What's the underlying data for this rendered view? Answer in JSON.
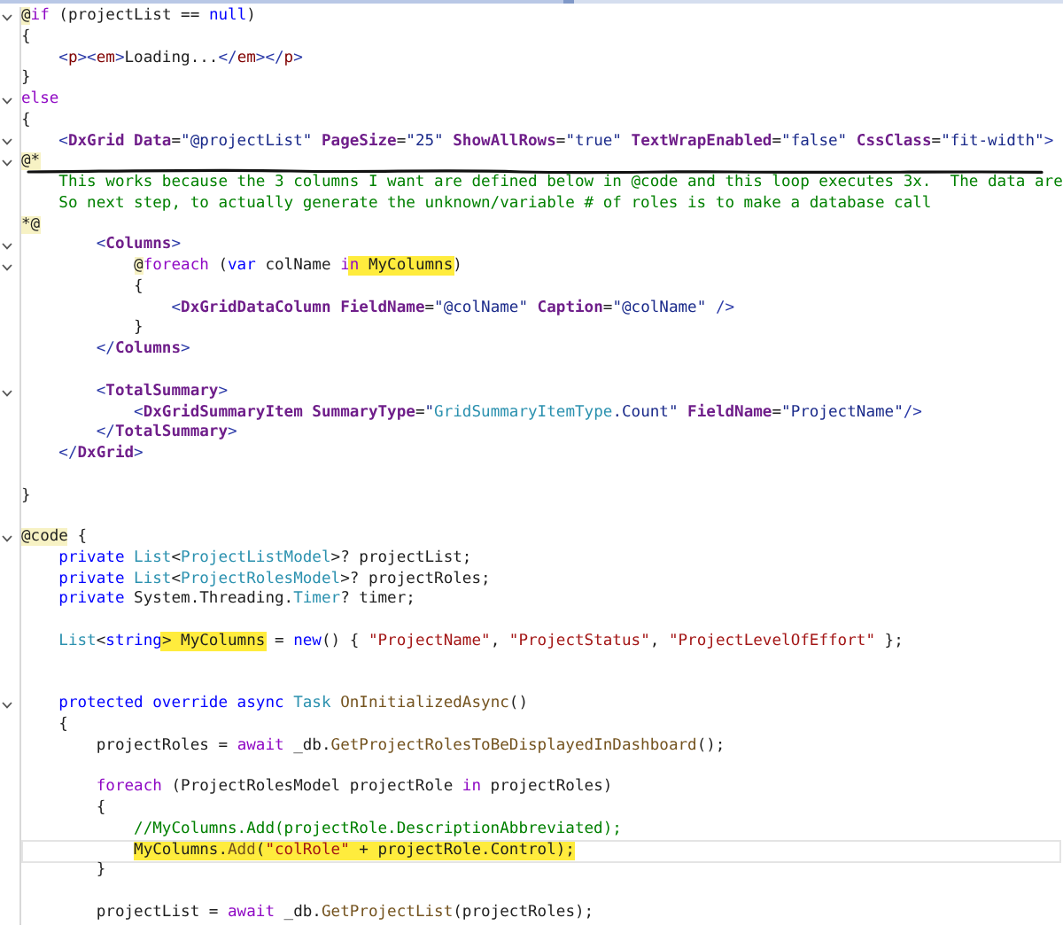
{
  "editor": {
    "lines": [
      {
        "kind": "code",
        "fold": true,
        "current": false,
        "struck": false,
        "tokens": [
          {
            "text": "@",
            "kind": "razor"
          },
          {
            "text": "if",
            "kind": "ctl"
          },
          {
            "text": " (projectList == ",
            "kind": "pl"
          },
          {
            "text": "null",
            "kind": "kw"
          },
          {
            "text": ")",
            "kind": "pl"
          }
        ]
      },
      {
        "kind": "code",
        "fold": false,
        "current": false,
        "struck": false,
        "tokens": [
          {
            "text": "{",
            "kind": "pl"
          }
        ],
        "children": [
          {
            "kind": "code",
            "fold": false,
            "current": false,
            "struck": false,
            "tokens": [
              {
                "text": "<",
                "kind": "dl"
              },
              {
                "text": "p",
                "kind": "tag"
              },
              {
                "text": "><",
                "kind": "dl"
              },
              {
                "text": "em",
                "kind": "tag"
              },
              {
                "text": ">",
                "kind": "dl"
              },
              {
                "text": "Loading...",
                "kind": "pl"
              },
              {
                "text": "</",
                "kind": "dl"
              },
              {
                "text": "em",
                "kind": "tag"
              },
              {
                "text": "></",
                "kind": "dl"
              },
              {
                "text": "p",
                "kind": "tag"
              },
              {
                "text": ">",
                "kind": "dl"
              }
            ]
          }
        ]
      },
      {
        "kind": "code",
        "fold": false,
        "current": false,
        "struck": false,
        "tokens": [
          {
            "text": "}",
            "kind": "pl"
          }
        ]
      },
      {
        "kind": "code",
        "fold": true,
        "current": false,
        "struck": false,
        "tokens": [
          {
            "text": "else",
            "kind": "ctl"
          }
        ]
      },
      {
        "kind": "code",
        "fold": false,
        "current": false,
        "struck": false,
        "tokens": [
          {
            "text": "{",
            "kind": "pl"
          }
        ],
        "children": [
          {
            "kind": "code",
            "fold": true,
            "current": false,
            "struck": false,
            "tokens": [
              {
                "text": "<",
                "kind": "dl"
              },
              {
                "text": "DxGrid",
                "kind": "comp"
              },
              {
                "text": " Data",
                "kind": "attr"
              },
              {
                "text": "=",
                "kind": "pl"
              },
              {
                "text": "\"@projectList\"",
                "kind": "val"
              },
              {
                "text": " PageSize",
                "kind": "attr"
              },
              {
                "text": "=",
                "kind": "pl"
              },
              {
                "text": "\"25\"",
                "kind": "val"
              },
              {
                "text": " ShowAllRows",
                "kind": "attr"
              },
              {
                "text": "=",
                "kind": "pl"
              },
              {
                "text": "\"true\"",
                "kind": "val"
              },
              {
                "text": " TextWrapEnabled",
                "kind": "attr"
              },
              {
                "text": "=",
                "kind": "pl"
              },
              {
                "text": "\"false\"",
                "kind": "val"
              },
              {
                "text": " CssClass",
                "kind": "attr"
              },
              {
                "text": "=",
                "kind": "pl"
              },
              {
                "text": "\"fit-width\"",
                "kind": "val"
              },
              {
                "text": ">",
                "kind": "dl"
              }
            ]
          }
        ]
      },
      {
        "kind": "code",
        "fold": true,
        "current": false,
        "struck": false,
        "tokens": [
          {
            "text": "@*",
            "kind": "razor"
          }
        ],
        "children": [
          {
            "kind": "code",
            "fold": false,
            "current": false,
            "struck": true,
            "tokens": [
              {
                "text": "This works because the 3 columns I want are defined below in @code and this loop executes 3x.  The data are",
                "kind": "cm"
              }
            ]
          },
          {
            "kind": "code",
            "fold": false,
            "current": false,
            "struck": false,
            "tokens": [
              {
                "text": "So next step, to actually generate the unknown/variable # of roles is to make a database call",
                "kind": "cm"
              }
            ]
          }
        ]
      },
      {
        "kind": "code",
        "fold": false,
        "current": false,
        "struck": false,
        "tokens": [
          {
            "text": "*@",
            "kind": "razor"
          }
        ],
        "children": [
          {
            "kind": "block",
            "children": [
              {
                "kind": "code",
                "fold": true,
                "current": false,
                "struck": false,
                "tokens": [
                  {
                    "text": "<",
                    "kind": "dl"
                  },
                  {
                    "text": "Columns",
                    "kind": "comp"
                  },
                  {
                    "text": ">",
                    "kind": "dl"
                  }
                ],
                "children": [
                  {
                    "kind": "code",
                    "fold": true,
                    "current": false,
                    "struck": false,
                    "tokens": [
                      {
                        "text": "@",
                        "kind": "razor",
                        "highlighted": false
                      },
                      {
                        "text": "foreach",
                        "kind": "ctl",
                        "highlighted": false
                      },
                      {
                        "text": " (",
                        "kind": "pl",
                        "highlighted": false
                      },
                      {
                        "text": "var",
                        "kind": "kw",
                        "highlighted": false
                      },
                      {
                        "text": " colName ",
                        "kind": "pl",
                        "highlighted": false
                      },
                      {
                        "text": "i",
                        "kind": "ctl",
                        "highlighted": false
                      },
                      {
                        "text": "n",
                        "kind": "ctl",
                        "highlighted": true
                      },
                      {
                        "text": " MyColumns",
                        "kind": "pl",
                        "highlighted": true
                      },
                      {
                        "text": ")",
                        "kind": "pl",
                        "highlighted": false
                      }
                    ]
                  },
                  {
                    "kind": "code",
                    "fold": false,
                    "current": false,
                    "struck": false,
                    "tokens": [
                      {
                        "text": "{",
                        "kind": "pl"
                      }
                    ],
                    "children": [
                      {
                        "kind": "code",
                        "fold": false,
                        "current": false,
                        "struck": false,
                        "tokens": [
                          {
                            "text": "<",
                            "kind": "dl"
                          },
                          {
                            "text": "DxGridDataColumn",
                            "kind": "comp"
                          },
                          {
                            "text": " FieldName",
                            "kind": "attr"
                          },
                          {
                            "text": "=",
                            "kind": "pl"
                          },
                          {
                            "text": "\"@colName\"",
                            "kind": "val"
                          },
                          {
                            "text": " Caption",
                            "kind": "attr"
                          },
                          {
                            "text": "=",
                            "kind": "pl"
                          },
                          {
                            "text": "\"@colName\"",
                            "kind": "val"
                          },
                          {
                            "text": " />",
                            "kind": "dl"
                          }
                        ]
                      }
                    ]
                  },
                  {
                    "kind": "code",
                    "fold": false,
                    "current": false,
                    "struck": false,
                    "tokens": [
                      {
                        "text": "}",
                        "kind": "pl"
                      }
                    ]
                  }
                ]
              },
              {
                "kind": "code",
                "fold": false,
                "current": false,
                "struck": false,
                "tokens": [
                  {
                    "text": "</",
                    "kind": "dl"
                  },
                  {
                    "text": "Columns",
                    "kind": "comp"
                  },
                  {
                    "text": ">",
                    "kind": "dl"
                  }
                ]
              },
              {
                "kind": "blank"
              },
              {
                "kind": "code",
                "fold": true,
                "current": false,
                "struck": false,
                "tokens": [
                  {
                    "text": "<",
                    "kind": "dl"
                  },
                  {
                    "text": "TotalSummary",
                    "kind": "comp"
                  },
                  {
                    "text": ">",
                    "kind": "dl"
                  }
                ],
                "children": [
                  {
                    "kind": "code",
                    "fold": false,
                    "current": false,
                    "struck": false,
                    "tokens": [
                      {
                        "text": "<",
                        "kind": "dl"
                      },
                      {
                        "text": "DxGridSummaryItem",
                        "kind": "comp"
                      },
                      {
                        "text": " SummaryType",
                        "kind": "attr"
                      },
                      {
                        "text": "=",
                        "kind": "pl"
                      },
                      {
                        "text": "\"",
                        "kind": "val"
                      },
                      {
                        "text": "GridSummaryItemType",
                        "kind": "type"
                      },
                      {
                        "text": ".Count\"",
                        "kind": "val"
                      },
                      {
                        "text": " FieldName",
                        "kind": "attr"
                      },
                      {
                        "text": "=",
                        "kind": "pl"
                      },
                      {
                        "text": "\"ProjectName\"",
                        "kind": "val"
                      },
                      {
                        "text": "/>",
                        "kind": "dl"
                      }
                    ]
                  }
                ]
              },
              {
                "kind": "code",
                "fold": false,
                "current": false,
                "struck": false,
                "tokens": [
                  {
                    "text": "</",
                    "kind": "dl"
                  },
                  {
                    "text": "TotalSummary",
                    "kind": "comp"
                  },
                  {
                    "text": ">",
                    "kind": "dl"
                  }
                ]
              }
            ]
          },
          {
            "kind": "code",
            "fold": false,
            "current": false,
            "struck": false,
            "tokens": [
              {
                "text": "</",
                "kind": "dl"
              },
              {
                "text": "DxGrid",
                "kind": "comp"
              },
              {
                "text": ">",
                "kind": "dl"
              }
            ]
          },
          {
            "kind": "blank"
          }
        ]
      },
      {
        "kind": "code",
        "fold": false,
        "current": false,
        "struck": false,
        "tokens": [
          {
            "text": "}",
            "kind": "pl"
          }
        ]
      },
      {
        "kind": "blank"
      },
      {
        "kind": "code",
        "fold": true,
        "current": false,
        "struck": false,
        "tokens": [
          {
            "text": "@code",
            "kind": "razor"
          },
          {
            "text": " {",
            "kind": "pl"
          }
        ],
        "children": [
          {
            "kind": "code",
            "fold": false,
            "current": false,
            "struck": false,
            "tokens": [
              {
                "text": "private",
                "kind": "kw"
              },
              {
                "text": " List",
                "kind": "type"
              },
              {
                "text": "<",
                "kind": "pl"
              },
              {
                "text": "ProjectListModel",
                "kind": "type"
              },
              {
                "text": ">? projectList;",
                "kind": "pl"
              }
            ]
          },
          {
            "kind": "code",
            "fold": false,
            "current": false,
            "struck": false,
            "tokens": [
              {
                "text": "private",
                "kind": "kw"
              },
              {
                "text": " List",
                "kind": "type"
              },
              {
                "text": "<",
                "kind": "pl"
              },
              {
                "text": "ProjectRolesModel",
                "kind": "type"
              },
              {
                "text": ">? projectRoles;",
                "kind": "pl"
              }
            ]
          },
          {
            "kind": "code",
            "fold": false,
            "current": false,
            "struck": false,
            "tokens": [
              {
                "text": "private",
                "kind": "kw"
              },
              {
                "text": " System.Threading.",
                "kind": "pl"
              },
              {
                "text": "Timer",
                "kind": "type"
              },
              {
                "text": "? timer;",
                "kind": "pl"
              }
            ]
          },
          {
            "kind": "blank"
          },
          {
            "kind": "code",
            "fold": false,
            "current": false,
            "struck": false,
            "tokens": [
              {
                "text": "List",
                "kind": "type",
                "highlighted": false
              },
              {
                "text": "<",
                "kind": "pl",
                "highlighted": false
              },
              {
                "text": "string",
                "kind": "kw",
                "highlighted": false
              },
              {
                "text": "> MyColumns",
                "kind": "pl",
                "highlighted": true
              },
              {
                "text": " = ",
                "kind": "pl",
                "highlighted": false
              },
              {
                "text": "new",
                "kind": "kw",
                "highlighted": false
              },
              {
                "text": "() { ",
                "kind": "pl",
                "highlighted": false
              },
              {
                "text": "\"ProjectName\"",
                "kind": "str",
                "highlighted": false
              },
              {
                "text": ", ",
                "kind": "pl",
                "highlighted": false
              },
              {
                "text": "\"ProjectStatus\"",
                "kind": "str",
                "highlighted": false
              },
              {
                "text": ", ",
                "kind": "pl",
                "highlighted": false
              },
              {
                "text": "\"ProjectLevelOfEffort\"",
                "kind": "str",
                "highlighted": false
              },
              {
                "text": " };",
                "kind": "pl",
                "highlighted": false
              }
            ]
          },
          {
            "kind": "blank"
          },
          {
            "kind": "blank"
          },
          {
            "kind": "code",
            "fold": true,
            "current": false,
            "struck": false,
            "tokens": [
              {
                "text": "protected",
                "kind": "kw"
              },
              {
                "text": " override",
                "kind": "kw"
              },
              {
                "text": " async",
                "kind": "kw"
              },
              {
                "text": " Task",
                "kind": "type"
              },
              {
                "text": " OnInitializedAsync",
                "kind": "fn"
              },
              {
                "text": "()",
                "kind": "pl"
              }
            ]
          },
          {
            "kind": "code",
            "fold": false,
            "current": false,
            "struck": false,
            "tokens": [
              {
                "text": "{",
                "kind": "pl"
              }
            ],
            "children": [
              {
                "kind": "code",
                "fold": false,
                "current": false,
                "struck": false,
                "tokens": [
                  {
                    "text": "projectRoles = ",
                    "kind": "pl"
                  },
                  {
                    "text": "await",
                    "kind": "ctl"
                  },
                  {
                    "text": " _db.",
                    "kind": "pl"
                  },
                  {
                    "text": "GetProjectRolesToBeDisplayedInDashboard",
                    "kind": "fn"
                  },
                  {
                    "text": "();",
                    "kind": "pl"
                  }
                ]
              },
              {
                "kind": "blank"
              },
              {
                "kind": "code",
                "fold": false,
                "current": false,
                "struck": false,
                "tokens": [
                  {
                    "text": "foreach",
                    "kind": "ctl"
                  },
                  {
                    "text": " (ProjectRolesModel projectRole ",
                    "kind": "pl"
                  },
                  {
                    "text": "in",
                    "kind": "ctl"
                  },
                  {
                    "text": " projectRoles)",
                    "kind": "pl"
                  }
                ]
              },
              {
                "kind": "code",
                "fold": false,
                "current": false,
                "struck": false,
                "tokens": [
                  {
                    "text": "{",
                    "kind": "pl"
                  }
                ],
                "children": [
                  {
                    "kind": "code",
                    "fold": false,
                    "current": false,
                    "struck": false,
                    "tokens": [
                      {
                        "text": "//MyColumns.Add(projectRole.DescriptionAbbreviated);",
                        "kind": "cm"
                      }
                    ]
                  },
                  {
                    "kind": "code",
                    "fold": false,
                    "current": true,
                    "struck": false,
                    "tokens": [
                      {
                        "text": "MyColumns.",
                        "kind": "pl",
                        "highlighted": true
                      },
                      {
                        "text": "Add",
                        "kind": "fn",
                        "highlighted": true
                      },
                      {
                        "text": "(",
                        "kind": "pl",
                        "highlighted": true
                      },
                      {
                        "text": "\"colRole\"",
                        "kind": "str",
                        "highlighted": true
                      },
                      {
                        "text": " + projectRole.Control);",
                        "kind": "pl",
                        "highlighted": true
                      }
                    ]
                  }
                ]
              },
              {
                "kind": "code",
                "fold": false,
                "current": false,
                "struck": false,
                "tokens": [
                  {
                    "text": "}",
                    "kind": "pl"
                  }
                ]
              },
              {
                "kind": "blank"
              },
              {
                "kind": "code",
                "fold": false,
                "current": false,
                "struck": false,
                "tokens": [
                  {
                    "text": "projectList = ",
                    "kind": "pl"
                  },
                  {
                    "text": "await",
                    "kind": "ctl"
                  },
                  {
                    "text": " _db.",
                    "kind": "pl"
                  },
                  {
                    "text": "GetProjectList",
                    "kind": "fn"
                  },
                  {
                    "text": "(projectRoles);",
                    "kind": "pl"
                  }
                ]
              }
            ]
          }
        ]
      }
    ]
  }
}
